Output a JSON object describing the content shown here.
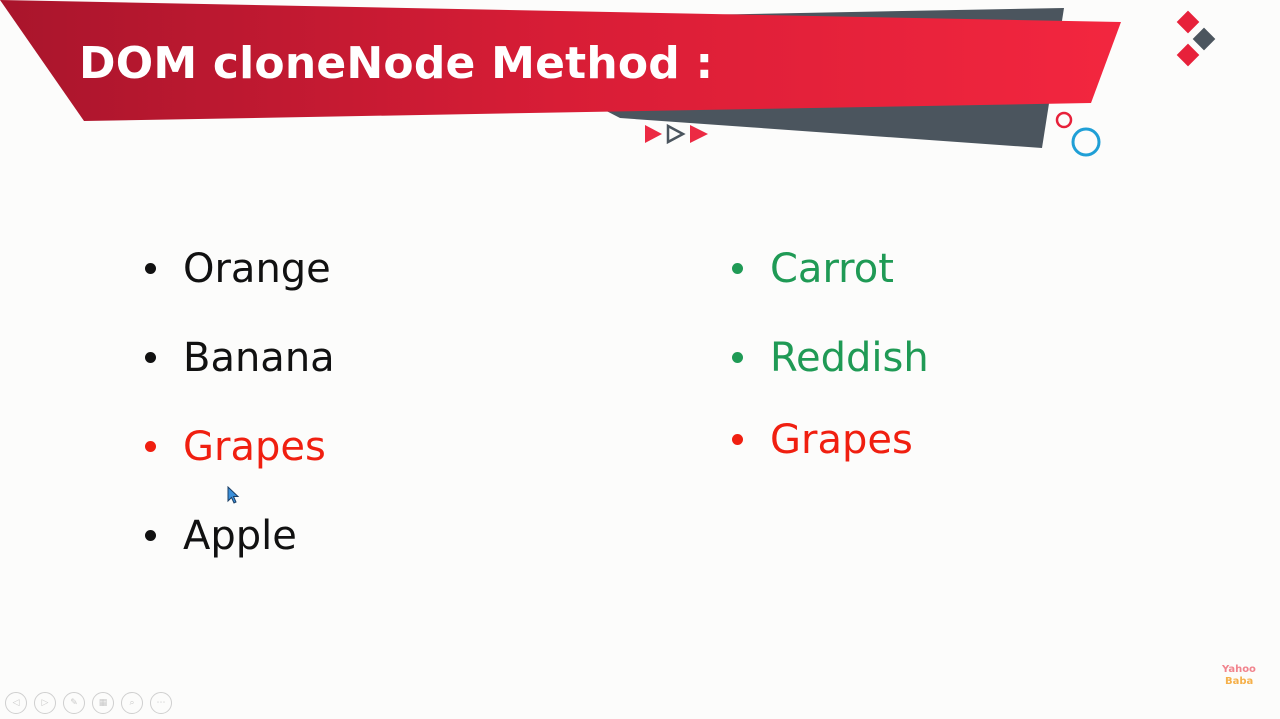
{
  "slide": {
    "title": "DOM cloneNode Method :",
    "colors": {
      "banner_red": "#e7213a",
      "banner_dark_red": "#b01630",
      "banner_gray": "#4b555e",
      "text_black": "#111111",
      "text_green": "#1f9a55",
      "text_red": "#f01f10",
      "accent_blue": "#1f9fd6"
    },
    "left_list": [
      {
        "text": "Orange",
        "color": "#111111"
      },
      {
        "text": "Banana",
        "color": "#111111"
      },
      {
        "text": "Grapes",
        "color": "#f01f10"
      },
      {
        "text": "Apple",
        "color": "#111111"
      }
    ],
    "right_list": [
      {
        "text": "Carrot",
        "color": "#1f9a55"
      },
      {
        "text": "Reddish",
        "color": "#1f9a55"
      },
      {
        "text": "Grapes",
        "color": "#f01f10"
      }
    ],
    "controls": [
      {
        "name": "previous-slide-button",
        "icon": "arrow-left-icon",
        "glyph": "◁"
      },
      {
        "name": "next-slide-button",
        "icon": "arrow-right-icon",
        "glyph": "▷"
      },
      {
        "name": "pen-button",
        "icon": "pen-icon",
        "glyph": "✎"
      },
      {
        "name": "slides-overview-button",
        "icon": "grid-icon",
        "glyph": "▦"
      },
      {
        "name": "zoom-button",
        "icon": "magnifier-icon",
        "glyph": "⌕"
      },
      {
        "name": "more-options-button",
        "icon": "ellipsis-icon",
        "glyph": "⋯"
      }
    ],
    "logo": {
      "line1": "Yahoo",
      "line2": "Baba"
    }
  }
}
